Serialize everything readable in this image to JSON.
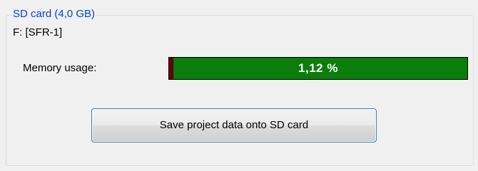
{
  "sd_card": {
    "title": "SD card (4,0 GB)",
    "drive": "F: [SFR-1]",
    "memory_label": "Memory usage:",
    "usage_text": "1,12 %",
    "usage_percent": 1.12,
    "colors": {
      "title": "#0046d5",
      "bar_free": "#0a7d0a",
      "bar_used": "#6b0000"
    }
  },
  "actions": {
    "save_label": "Save project data onto SD card"
  }
}
